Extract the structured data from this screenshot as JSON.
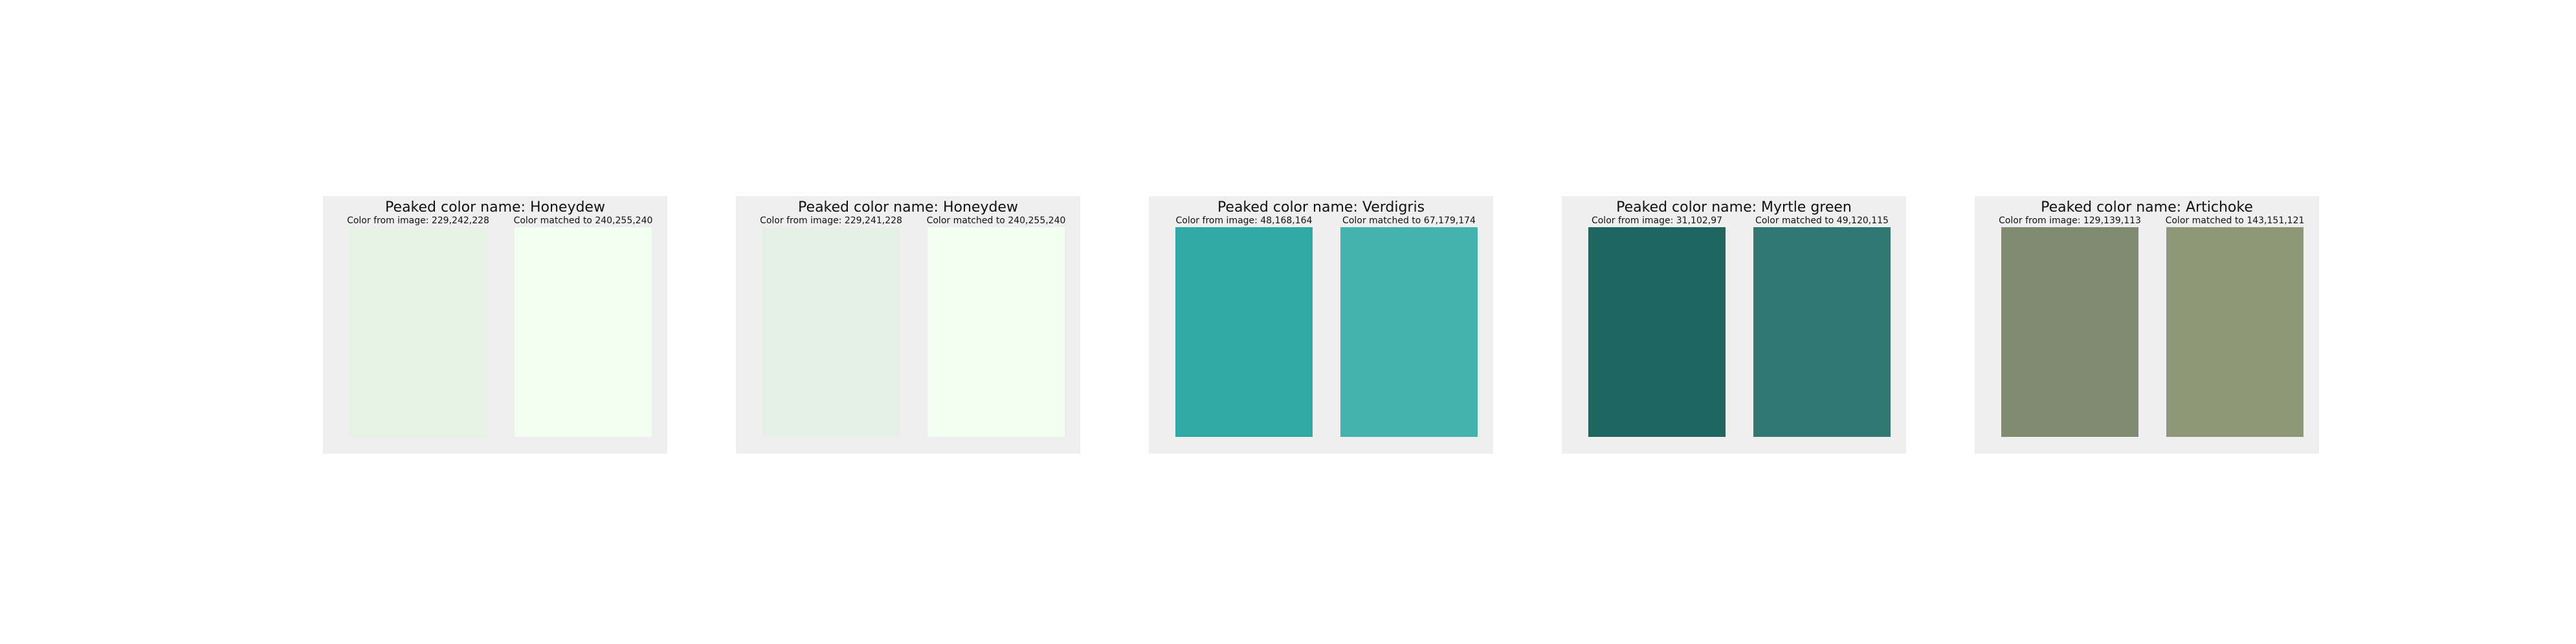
{
  "chart_data": {
    "type": "color-swatch-comparison",
    "panels": [
      {
        "title": "Peaked color name: Honeydew",
        "image_label": "Color from image: 229,242,228",
        "matched_label": "Color matched to 240,255,240",
        "image_rgb": [
          229,
          242,
          228
        ],
        "matched_rgb": [
          240,
          255,
          240
        ]
      },
      {
        "title": "Peaked color name: Honeydew",
        "image_label": "Color from image: 229,241,228",
        "matched_label": "Color matched to 240,255,240",
        "image_rgb": [
          229,
          241,
          228
        ],
        "matched_rgb": [
          240,
          255,
          240
        ]
      },
      {
        "title": "Peaked color name: Verdigris",
        "image_label": "Color from image: 48,168,164",
        "matched_label": "Color matched to 67,179,174",
        "image_rgb": [
          48,
          168,
          164
        ],
        "matched_rgb": [
          67,
          179,
          174
        ]
      },
      {
        "title": "Peaked color name: Myrtle green",
        "image_label": "Color from image: 31,102,97",
        "matched_label": "Color matched to 49,120,115",
        "image_rgb": [
          31,
          102,
          97
        ],
        "matched_rgb": [
          49,
          120,
          115
        ]
      },
      {
        "title": "Peaked color name: Artichoke",
        "image_label": "Color from image: 129,139,113",
        "matched_label": "Color matched to 143,151,121",
        "image_rgb": [
          129,
          139,
          113
        ],
        "matched_rgb": [
          143,
          151,
          121
        ]
      }
    ]
  },
  "colors": {
    "panel_background": "#efefef",
    "page_background": "#ffffff"
  }
}
